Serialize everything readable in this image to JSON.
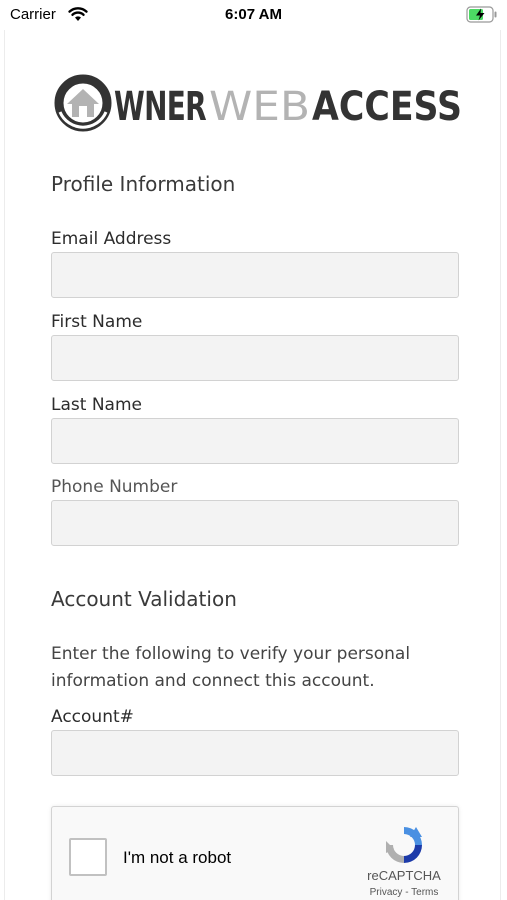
{
  "status_bar": {
    "carrier": "Carrier",
    "time": "6:07 AM",
    "icons": [
      "wifi-icon",
      "battery-charging-icon"
    ],
    "battery_color": "#4cd964"
  },
  "logo": {
    "text_owner_tail": "WNER",
    "text_web": "WEB",
    "text_access": "ACCESS",
    "colors": {
      "dark": "#333333",
      "light": "#b3b3b3"
    }
  },
  "profile": {
    "heading": "Profile Information",
    "email_label": "Email Address",
    "email_value": "",
    "first_name_label": "First Name",
    "first_name_value": "",
    "last_name_label": "Last Name",
    "last_name_value": "",
    "phone_label": "Phone Number",
    "phone_value": ""
  },
  "validation": {
    "heading": "Account Validation",
    "description": "Enter the following to verify your personal information and connect this account.",
    "account_label": "Account#",
    "account_value": ""
  },
  "captcha": {
    "label": "I'm not a robot",
    "brand": "reCAPTCHA",
    "links": "Privacy - Terms",
    "checked": false
  }
}
